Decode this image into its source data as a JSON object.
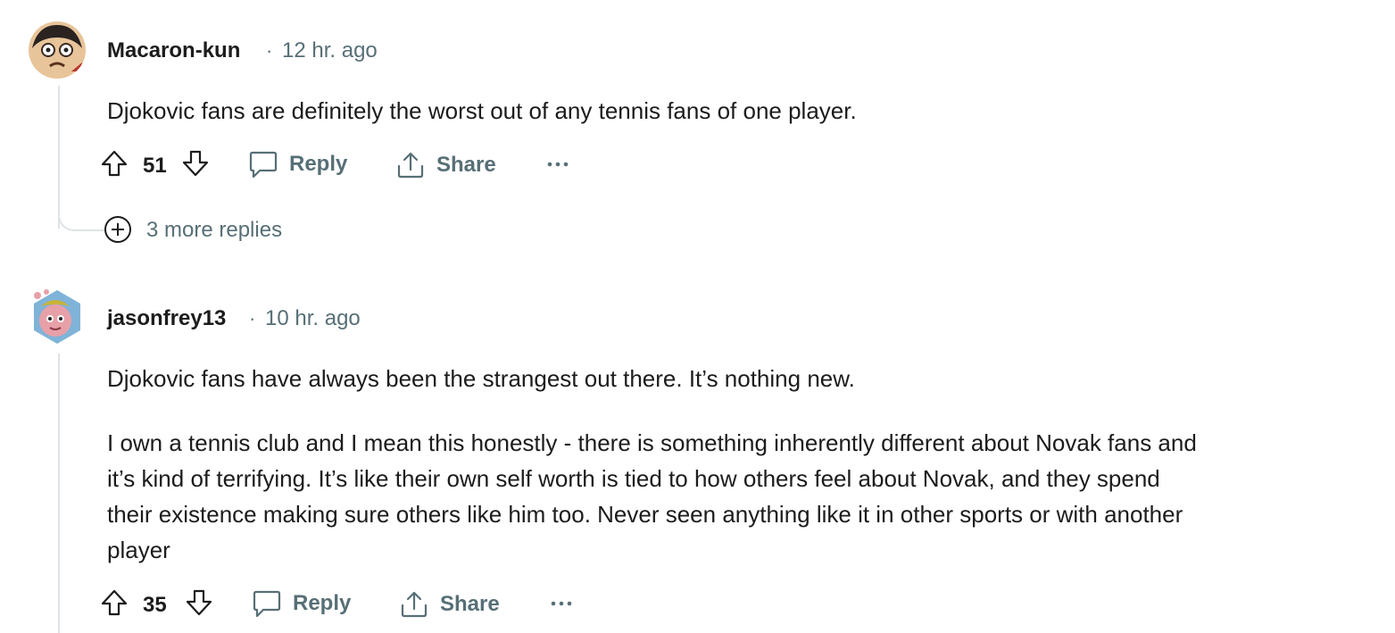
{
  "comments": [
    {
      "username": "Macaron-kun",
      "time": "12 hr. ago",
      "body": [
        "Djokovic fans are definitely the worst out of any tennis fans of one player."
      ],
      "score": "51",
      "reply_label": "Reply",
      "share_label": "Share",
      "more_replies": "3 more replies",
      "avatar_icon": "avatar-monkey-d-luffy-icon"
    },
    {
      "username": "jasonfrey13",
      "time": "10 hr. ago",
      "body": [
        "Djokovic fans have always been the strangest out there. It’s nothing new.",
        "I own a tennis club and I mean this honestly - there is something inherently different about Novak fans and",
        "it’s kind of terrifying. It’s like their own self worth is tied to how others feel about Novak, and they spend",
        "their existence making sure others like him too. Never seen anything like it in other sports or with another",
        "player"
      ],
      "score": "35",
      "reply_label": "Reply",
      "share_label": "Share",
      "avatar_icon": "avatar-snoo-creature-icon"
    }
  ],
  "colors": {
    "text": "#1c1c1c",
    "meta": "#576f76",
    "thread_line": "#dfe3e6"
  }
}
